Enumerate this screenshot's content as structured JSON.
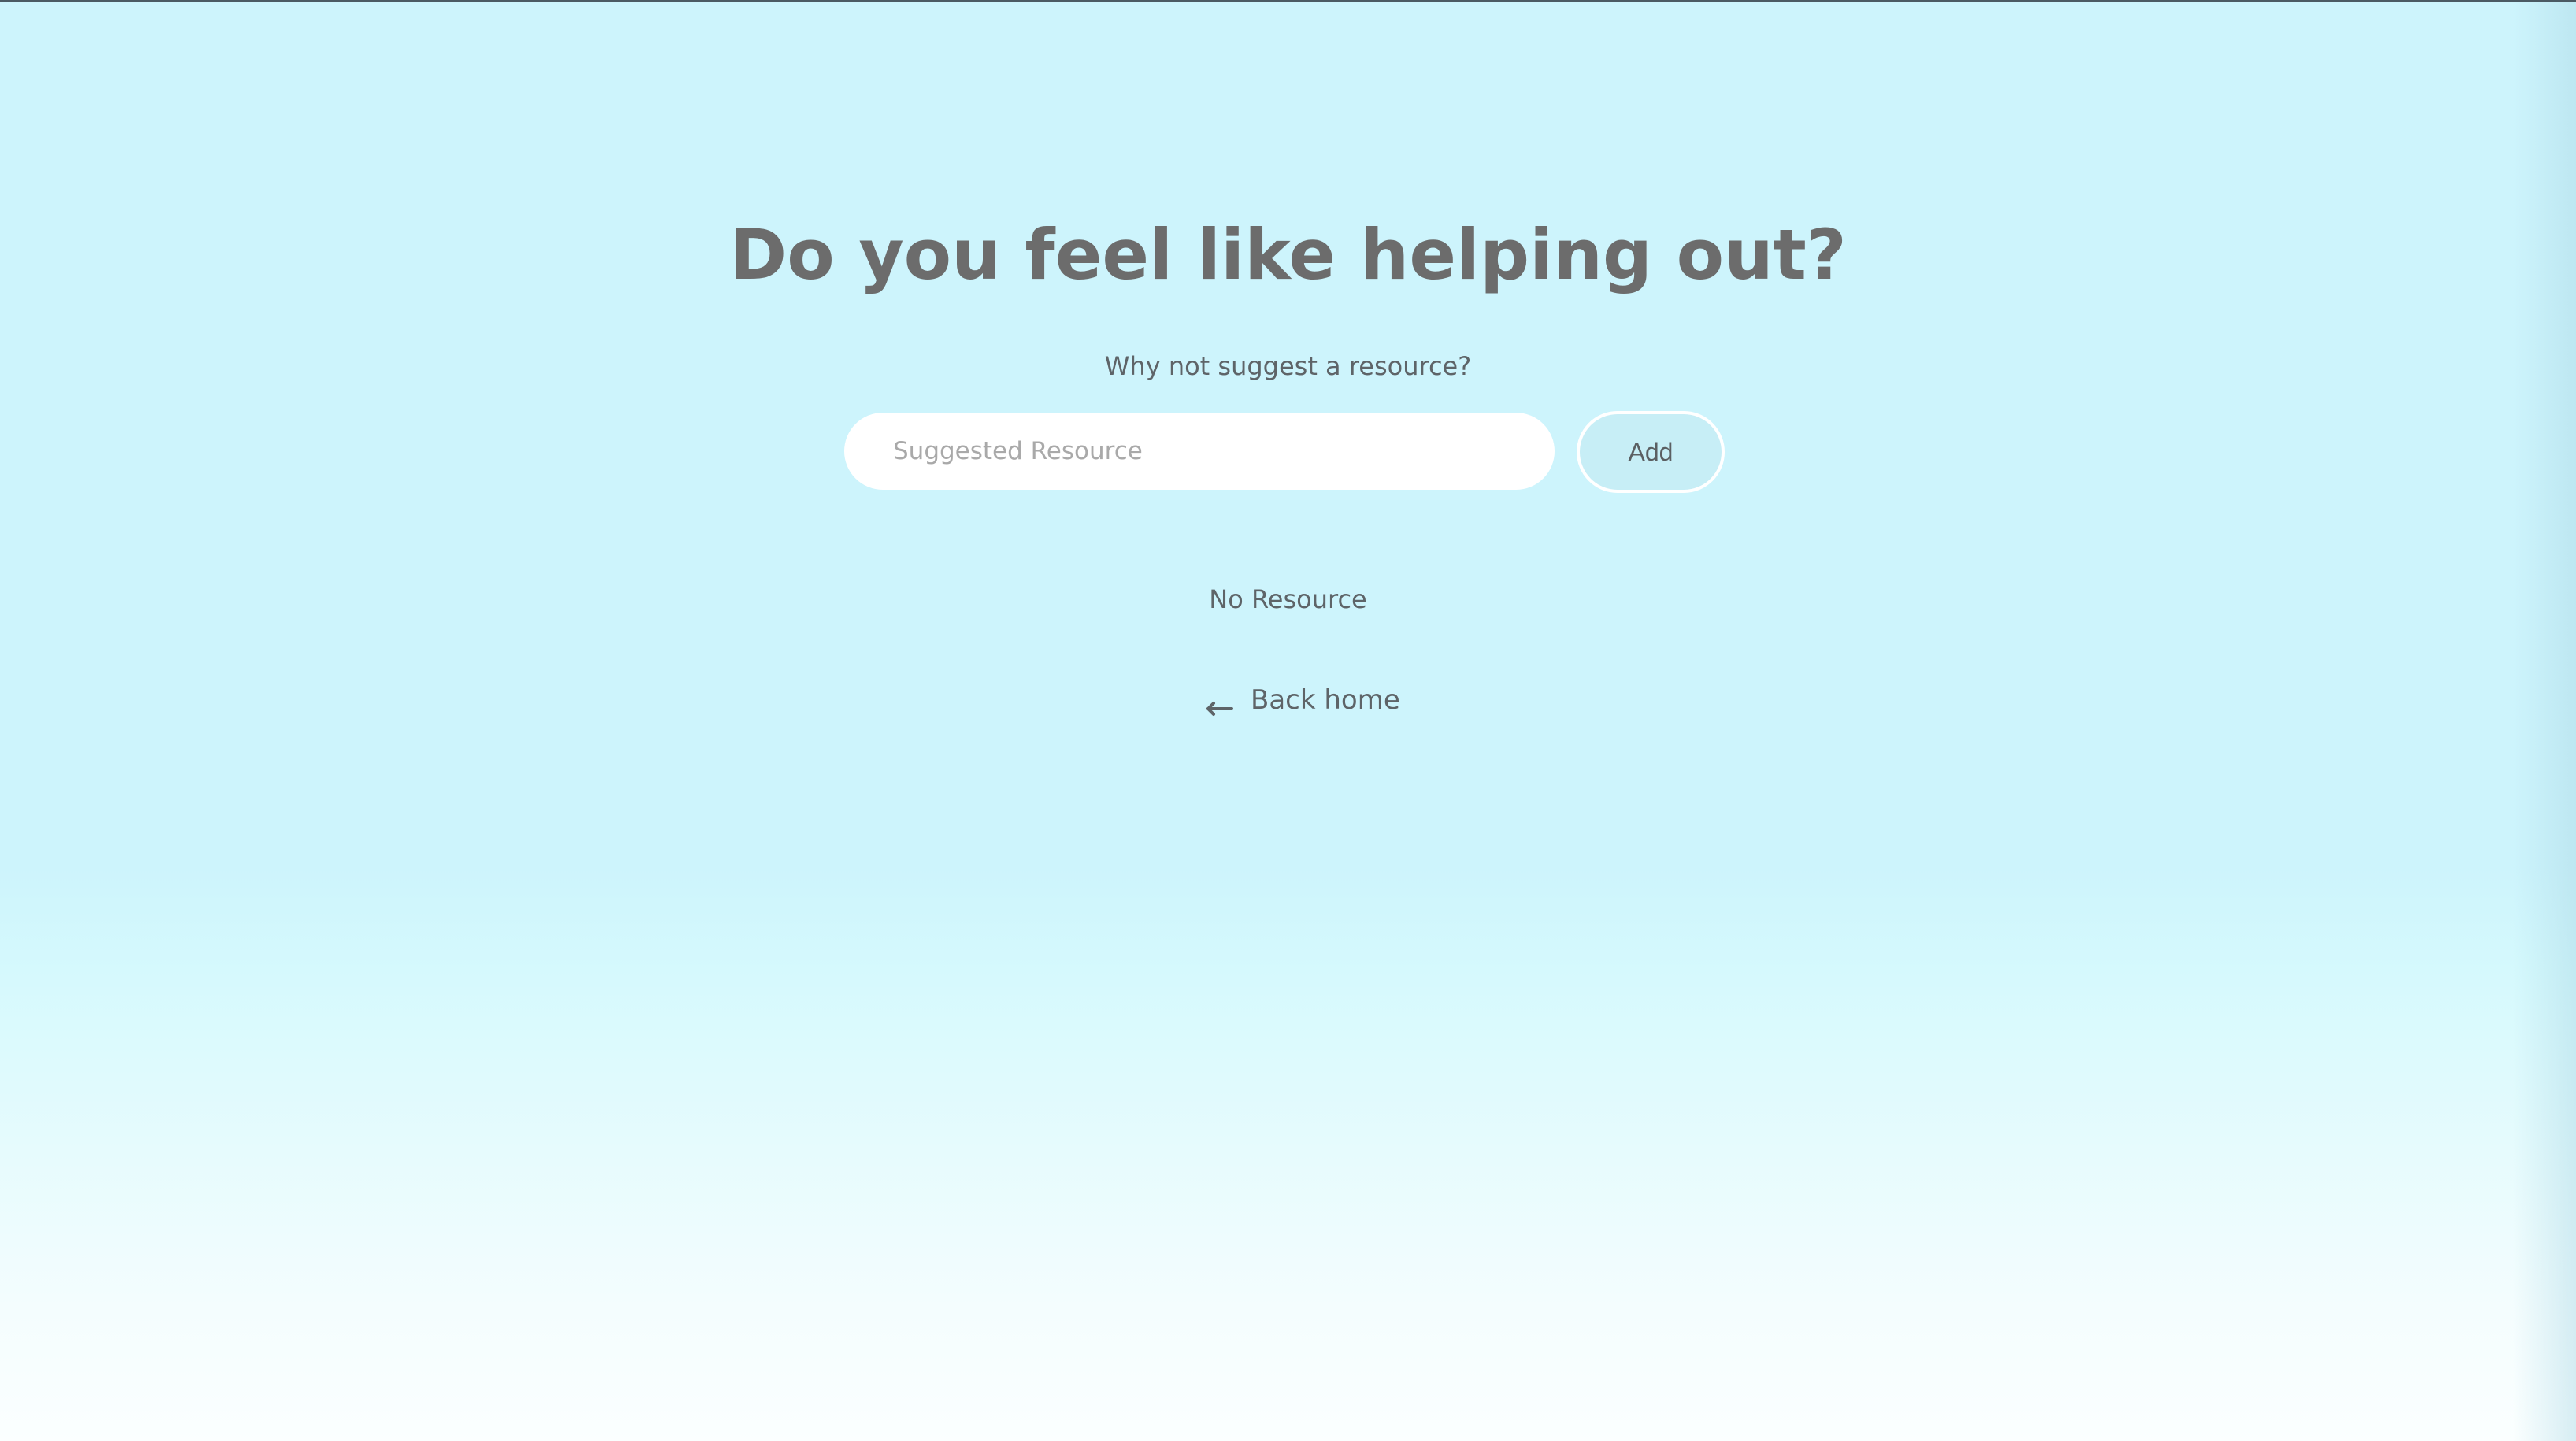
{
  "main": {
    "title": "Do you feel like helping out?",
    "subtitle": "Why not suggest a resource?",
    "form": {
      "input_placeholder": "Suggested Resource",
      "input_value": "",
      "add_label": "Add"
    },
    "empty_state": "No Resource",
    "back_link": {
      "label": "Back home",
      "icon": "arrow-left-icon"
    }
  },
  "colors": {
    "background_top": "#cdf4fc",
    "background_bottom": "#fbffff",
    "text": "#6c6c6c",
    "button_fill": "#c7eef6",
    "input_fill": "#ffffff"
  }
}
